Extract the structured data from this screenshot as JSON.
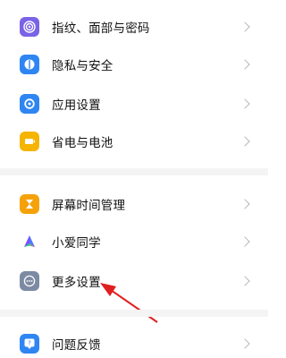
{
  "settings": {
    "items": [
      {
        "label": "指纹、面部与密码",
        "icon": "fingerprint-icon",
        "color": "#7a63e6"
      },
      {
        "label": "隐私与安全",
        "icon": "privacy-icon",
        "color": "#2f86f2"
      },
      {
        "label": "应用设置",
        "icon": "app-settings-icon",
        "color": "#2f86f2"
      },
      {
        "label": "省电与电池",
        "icon": "battery-icon",
        "color": "#f4b400"
      },
      {
        "label": "屏幕时间管理",
        "icon": "hourglass-icon",
        "color": "#f5a20a"
      },
      {
        "label": "小爱同学",
        "icon": "xiaoai-icon",
        "color": "#4d7cff"
      },
      {
        "label": "更多设置",
        "icon": "more-icon",
        "color": "#7d8aa3"
      },
      {
        "label": "问题反馈",
        "icon": "feedback-icon",
        "color": "#2f86f2"
      }
    ]
  },
  "annotation": {
    "type": "arrow",
    "color": "#e02020"
  }
}
